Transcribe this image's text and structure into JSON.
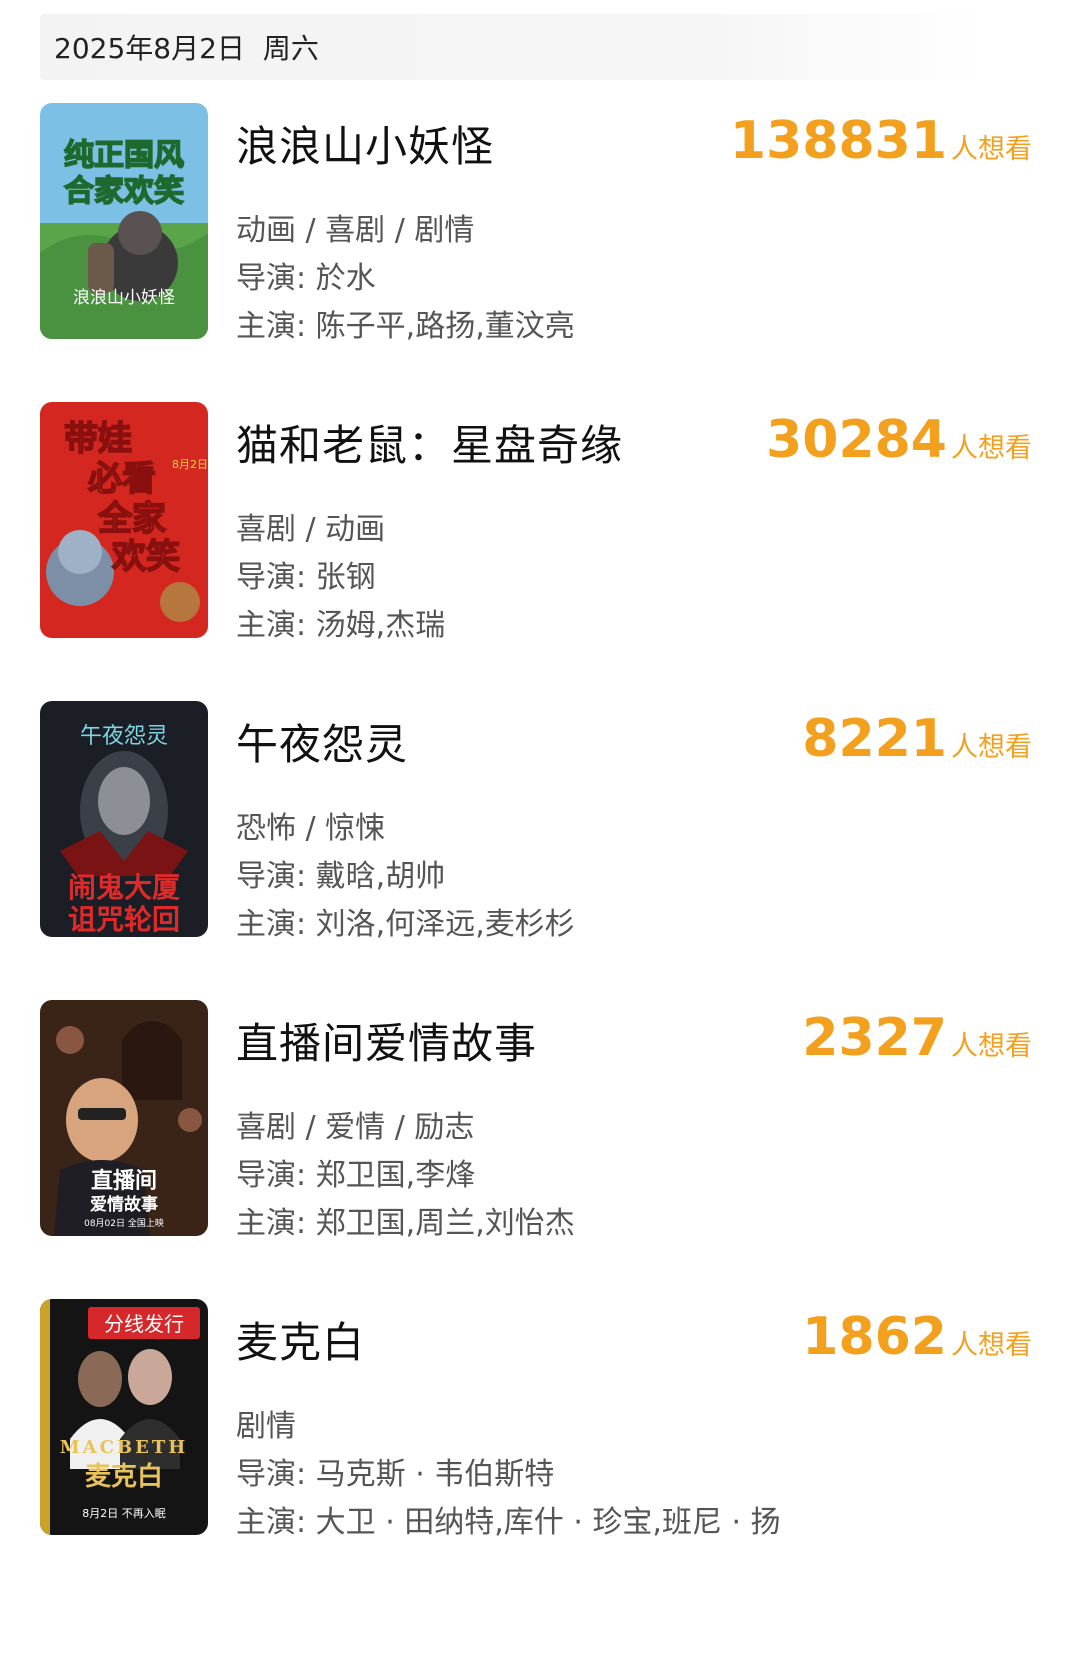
{
  "header": {
    "date": "2025年8月2日",
    "weekday": "周六"
  },
  "want_suffix": "人想看",
  "labels": {
    "director": "导演: ",
    "cast": "主演: "
  },
  "movies": [
    {
      "title": "浪浪山小妖怪",
      "want_count": "138831",
      "genres": "动画 / 喜剧 / 剧情",
      "director": "於水",
      "cast": "陈子平,路扬,董汶亮",
      "poster": {
        "lines": [
          "纯正国风",
          "合家欢笑"
        ],
        "tagline": "浪浪山小妖怪",
        "bg": "#5aa54a",
        "text_color": "#f6d21a"
      }
    },
    {
      "title": "猫和老鼠：星盘奇缘",
      "want_count": "30284",
      "genres": "喜剧 / 动画",
      "director": "张钢",
      "cast": "汤姆,杰瑞",
      "poster": {
        "lines": [
          "带娃",
          "必看",
          "全家",
          "欢笑"
        ],
        "tagline": "8月2日",
        "bg": "#d3271f",
        "text_color": "#ffd23a"
      }
    },
    {
      "title": "午夜怨灵",
      "want_count": "8221",
      "genres": "恐怖 / 惊悚",
      "director": "戴晗,胡帅",
      "cast": "刘洛,何泽远,麦杉杉",
      "poster": {
        "lines": [
          "闹鬼大厦",
          "诅咒轮回"
        ],
        "tagline": "午夜怨灵",
        "bg": "#1b1e25",
        "text_color": "#e02a2a"
      }
    },
    {
      "title": "直播间爱情故事",
      "want_count": "2327",
      "genres": "喜剧 / 爱情 / 励志",
      "director": "郑卫国,李烽",
      "cast": "郑卫国,周兰,刘怡杰",
      "poster": {
        "lines": [
          "直播间",
          "爱情故事"
        ],
        "tagline": "08月02日 全国上映",
        "bg": "#3a2418",
        "text_color": "#ffffff"
      }
    },
    {
      "title": "麦克白",
      "want_count": "1862",
      "genres": "剧情",
      "director": "马克斯 · 韦伯斯特",
      "cast": "大卫 · 田纳特,库什 · 珍宝,班尼 · 扬",
      "poster": {
        "lines": [
          "MACBETH",
          "麦克白"
        ],
        "badge": "分线发行",
        "tagline": "8月2日 不再入眠",
        "bg": "#141414",
        "text_color": "#e8c25a",
        "badge_color": "#d6282b"
      }
    }
  ]
}
